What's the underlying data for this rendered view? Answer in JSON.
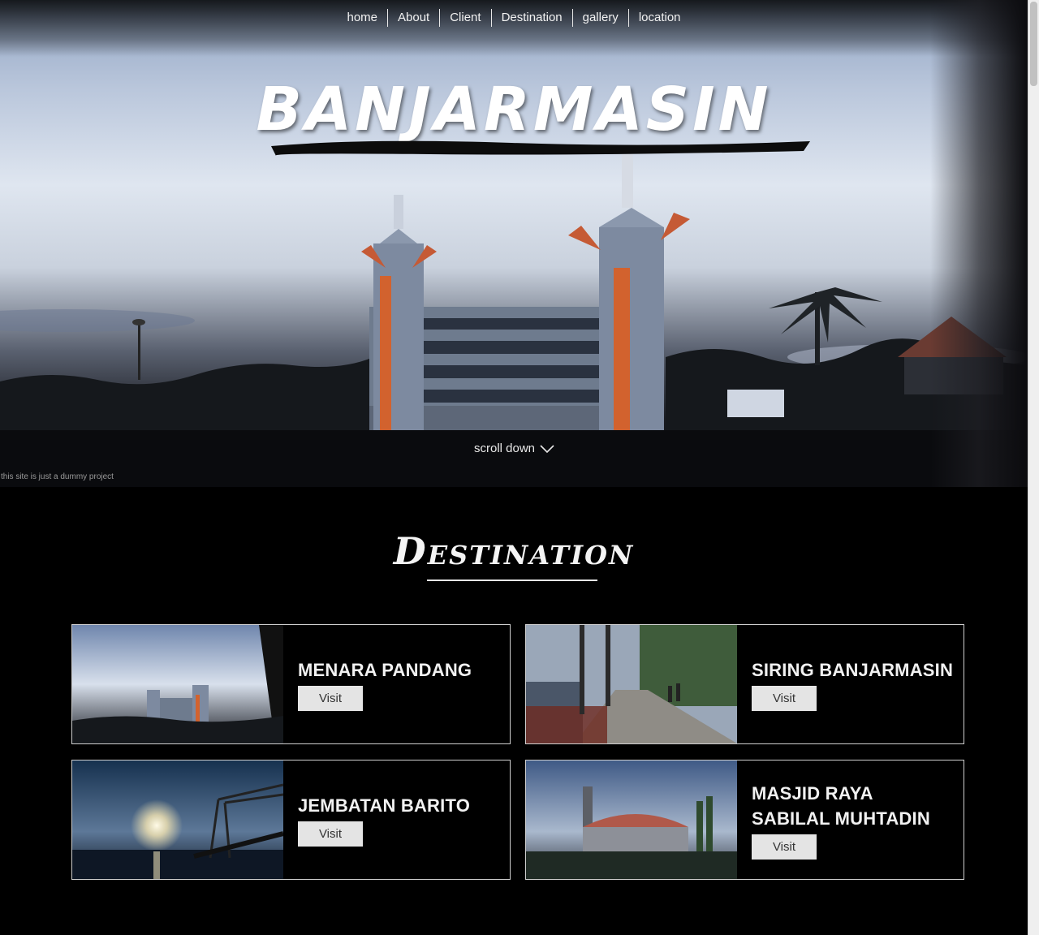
{
  "nav": {
    "items": [
      "home",
      "About",
      "Client",
      "Destination",
      "gallery",
      "location"
    ]
  },
  "hero": {
    "title": "BANJARMASIN",
    "scroll_label": "scroll down",
    "note": "this site is just a dummy project"
  },
  "destination": {
    "heading": "Destination",
    "visit_label": "Visit",
    "cards": [
      {
        "name": "MENARA PANDANG"
      },
      {
        "name": "SIRING BANJARMASIN"
      },
      {
        "name": "JEMBATAN BARITO"
      },
      {
        "name": "MASJID RAYA SABILAL MUHTADIN"
      }
    ]
  },
  "colors": {
    "background": "#000000",
    "text": "#ffffff",
    "button_bg": "#e4e4e4",
    "card_border": "#cfcfcf",
    "tower_accent": "#d2622e"
  }
}
